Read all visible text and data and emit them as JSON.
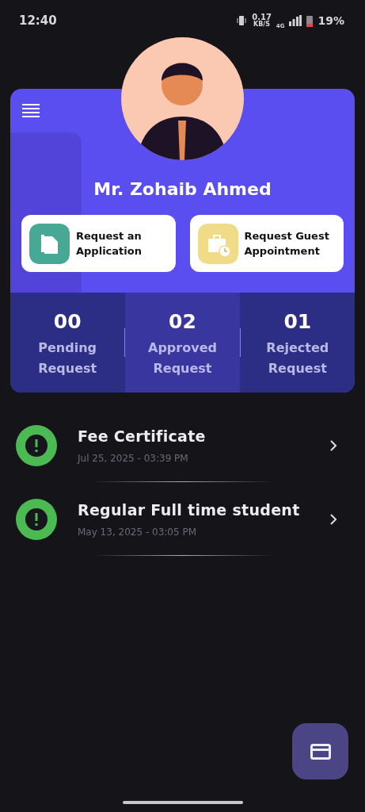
{
  "status_bar": {
    "time": "12:40",
    "speed": "0.17",
    "speed_unit": "KB/S",
    "network": "4G",
    "battery": "19%"
  },
  "profile": {
    "name": "Mr. Zohaib Ahmed"
  },
  "actions": [
    {
      "kind": "application",
      "label": "Request an Application"
    },
    {
      "kind": "appointment",
      "label": "Request Guest Appointment"
    }
  ],
  "stats": [
    {
      "count": "00",
      "label": "Pending Request",
      "selected": false
    },
    {
      "count": "02",
      "label": "Approved Request",
      "selected": true
    },
    {
      "count": "01",
      "label": "Rejected Request",
      "selected": false
    }
  ],
  "requests": [
    {
      "title": "Fee Certificate",
      "date": "Jul 25, 2025 - 03:39 PM"
    },
    {
      "title": "Regular Full time student",
      "date": "May 13, 2025 - 03:05 PM"
    }
  ]
}
